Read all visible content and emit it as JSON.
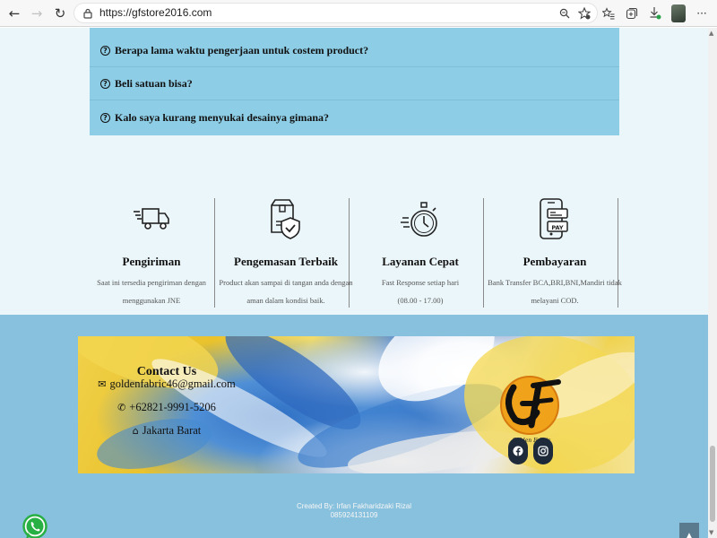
{
  "browser": {
    "url": "https://gfstore2016.com",
    "back_icon": "←",
    "forward_icon": "→",
    "reload_icon": "↻",
    "more_icon": "···"
  },
  "faq": {
    "items": [
      {
        "question": "Berapa lama waktu pengerjaan untuk costem product?"
      },
      {
        "question": "Beli satuan bisa?"
      },
      {
        "question": "Kalo saya kurang menyukai desainya gimana?"
      }
    ]
  },
  "features": [
    {
      "icon": "delivery-truck-icon",
      "title": "Pengiriman",
      "desc_line1": "Saat ini tersedia pengiriman dengan",
      "desc_line2": "menggunakan JNE"
    },
    {
      "icon": "shield-box-icon",
      "title": "Pengemasan Terbaik",
      "desc_line1": "Product akan sampai di tangan anda dengan",
      "desc_line2": "aman dalam kondisi baik."
    },
    {
      "icon": "stopwatch-icon",
      "title": "Layanan Cepat",
      "desc_line1": "Fast Response setiap hari",
      "desc_line2": "(08.00 - 17.00)"
    },
    {
      "icon": "phone-pay-icon",
      "title": "Pembayaran",
      "desc_line1": "Bank Transfer BCA,BRI,BNI,Mandiri tidak",
      "desc_line2": "melayani COD."
    }
  ],
  "contact": {
    "title": "Contact Us",
    "email": "goldenfabric46@gmail.com",
    "phone": "+62821-9991-5206",
    "location": "Jakarta Barat"
  },
  "logo": {
    "letters": "GF",
    "caption": "Golden Fabric"
  },
  "social": [
    "facebook-icon",
    "instagram-icon"
  ],
  "footer": {
    "credit_line1": "Created By: Irfan Fakharidzaki Rizal",
    "credit_line2": "085924131109"
  },
  "colors": {
    "faq_bg": "#8dcde6",
    "page_bg": "#ebf6fa",
    "contact_band": "#88c1dd",
    "to_top_button": "#5a7a8e"
  }
}
